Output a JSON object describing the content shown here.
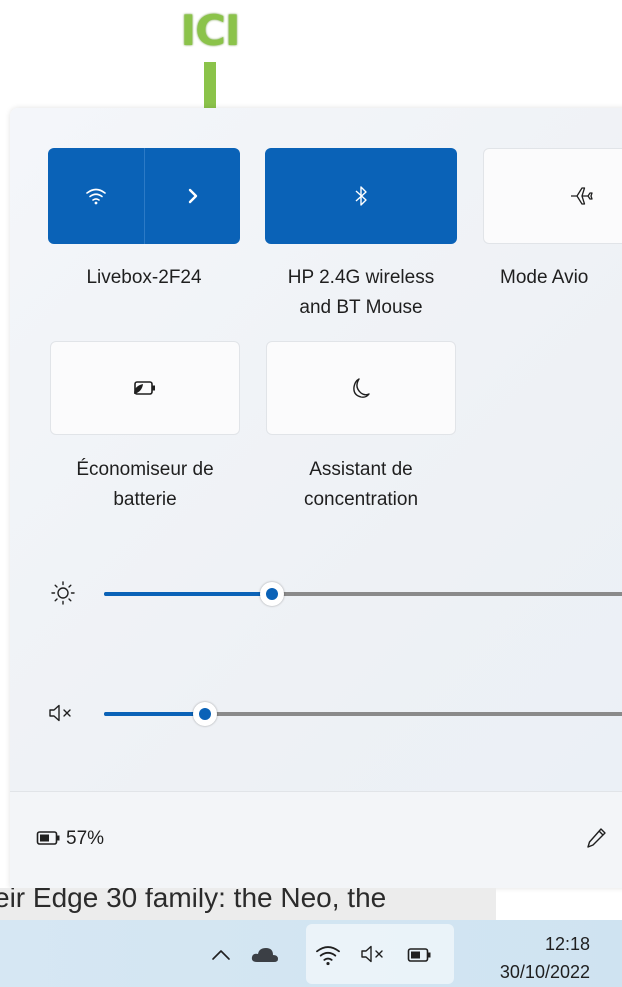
{
  "annotation": {
    "label": "ICI",
    "color": "#8bc34a"
  },
  "quick_settings": {
    "tiles": [
      {
        "id": "wifi",
        "label": "Livebox-2F24",
        "active": true,
        "icon": "wifi-icon",
        "secondary_icon": "chevron-right-icon"
      },
      {
        "id": "bluetooth",
        "label_line1": "HP 2.4G wireless",
        "label_line2": "and BT Mouse",
        "active": true,
        "icon": "bluetooth-icon"
      },
      {
        "id": "airplane",
        "label": "Mode Avio",
        "active": false,
        "icon": "airplane-icon"
      },
      {
        "id": "battery-saver",
        "label_line1": "Économiseur de",
        "label_line2": "batterie",
        "active": false,
        "icon": "battery-saver-icon"
      },
      {
        "id": "focus",
        "label_line1": "Assistant de",
        "label_line2": "concentration",
        "active": false,
        "icon": "moon-icon"
      }
    ],
    "brightness": {
      "icon": "sun-icon",
      "level_percent": 27
    },
    "volume": {
      "icon": "speaker-muted-icon",
      "level_percent": 16
    },
    "footer": {
      "battery_percent": "57%",
      "battery_icon": "battery-icon",
      "edit_icon": "pencil-icon"
    }
  },
  "background_text": "eir Edge 30 family: the Neo, the",
  "taskbar": {
    "tray_icons": [
      "chevron-up-icon",
      "cloud-icon",
      "wifi-icon",
      "speaker-muted-icon",
      "battery-icon"
    ],
    "time": "12:18",
    "date": "30/10/2022"
  },
  "colors": {
    "accent": "#0a62b7",
    "annotation": "#8bc34a"
  }
}
